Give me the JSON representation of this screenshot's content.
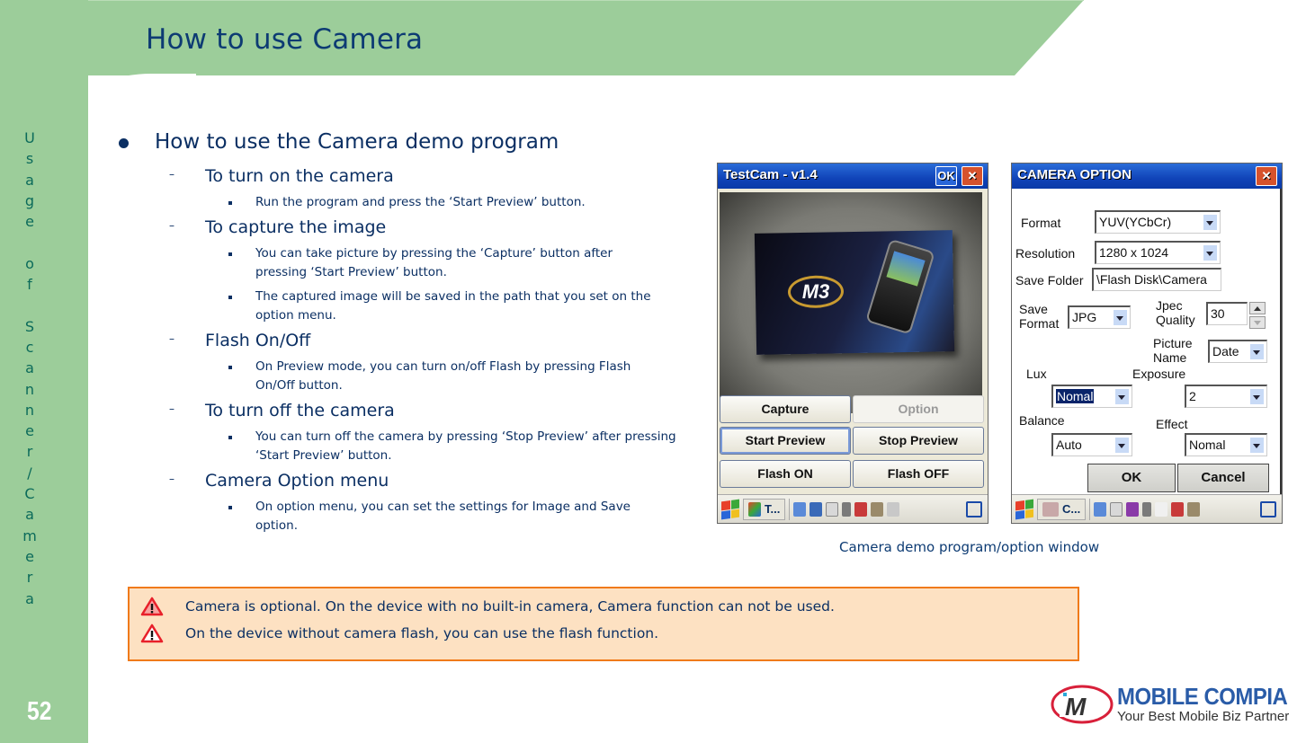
{
  "slide": {
    "title": "How to use Camera",
    "page_number": "52",
    "side_label": "Usage of Scanner/Camera",
    "colors": {
      "header_green": "#9ccd9a",
      "title_blue": "#0d3b73",
      "notice_bg": "#fde1c2",
      "notice_border": "#f07a1a"
    }
  },
  "content": {
    "heading": "How to use the Camera demo program",
    "sections": [
      {
        "title": "To turn on the camera",
        "items": [
          "Run the program and press the ‘Start Preview’ button."
        ]
      },
      {
        "title": "To capture the image",
        "items": [
          "You can take picture by pressing the ‘Capture’ button after pressing ‘Start Preview’ button.",
          "The captured image will be saved in the path that you set on the option menu."
        ]
      },
      {
        "title": "Flash On/Off",
        "items": [
          "On Preview mode, you can turn on/off Flash by pressing Flash On/Off button."
        ]
      },
      {
        "title": "To turn off the camera",
        "items": [
          "You can turn off the camera by pressing ‘Stop Preview’ after pressing ‘Start Preview’ button."
        ]
      },
      {
        "title": "Camera Option menu",
        "items": [
          "On option menu, you can set the settings for Image and Save option."
        ]
      }
    ]
  },
  "testcam": {
    "window_title": "TestCam - v1.4",
    "ok_label": "OK",
    "close_label": "✕",
    "box_logo": "M3",
    "buttons": {
      "capture": "Capture",
      "option": "Option",
      "start_preview": "Start Preview",
      "stop_preview": "Stop Preview",
      "flash_on": "Flash ON",
      "flash_off": "Flash OFF"
    },
    "taskbar_item": "T..."
  },
  "camera_option": {
    "window_title": "CAMERA OPTION",
    "close_label": "✕",
    "format_label": "Format",
    "format_value": "YUV(YCbCr)",
    "resolution_label": "Resolution",
    "resolution_value": "1280 x 1024",
    "save_folder_label": "Save Folder",
    "save_folder_value": "\\Flash Disk\\Camera",
    "save_format_label_1": "Save",
    "save_format_label_2": "Format",
    "save_format_value": "JPG",
    "jpec_quality_label_1": "Jpec",
    "jpec_quality_label_2": "Quality",
    "jpec_quality_value": "30",
    "picture_name_label_1": "Picture",
    "picture_name_label_2": "Name",
    "picture_name_value": "Date",
    "lux_label": "Lux",
    "lux_value": "Nomal",
    "exposure_label": "Exposure",
    "exposure_value": "2",
    "balance_label": "Balance",
    "balance_value": "Auto",
    "effect_label": "Effect",
    "effect_value": "Nomal",
    "ok_label": "OK",
    "cancel_label": "Cancel",
    "taskbar_item": "C..."
  },
  "caption": "Camera demo program/option window",
  "notices": [
    "Camera is optional. On the device with no built-in camera, Camera function can not be used.",
    "On the device without camera flash, you can use the flash function."
  ],
  "logo": {
    "mark": "M",
    "name": "MOBILE COMPIA",
    "tagline": "Your Best Mobile Biz Partner"
  }
}
